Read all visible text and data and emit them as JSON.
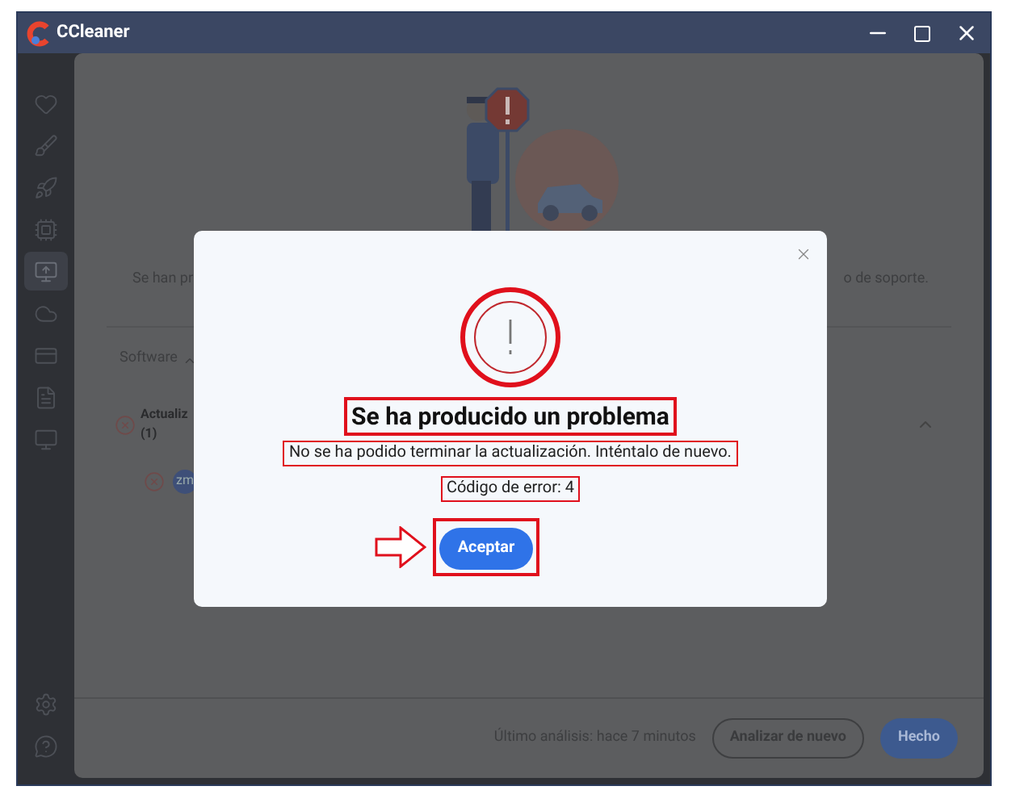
{
  "window": {
    "title": "CCleaner"
  },
  "sidebar": {
    "items": [
      {
        "kind": "heart",
        "selected": false
      },
      {
        "kind": "brush",
        "selected": false
      },
      {
        "kind": "rocket",
        "selected": false
      },
      {
        "kind": "chip",
        "selected": false
      },
      {
        "kind": "updater",
        "selected": true
      },
      {
        "kind": "cloud",
        "selected": false
      },
      {
        "kind": "card",
        "selected": false
      },
      {
        "kind": "file",
        "selected": false
      },
      {
        "kind": "monitor",
        "selected": false
      }
    ],
    "bottom_items": [
      {
        "kind": "settings",
        "selected": false
      },
      {
        "kind": "support",
        "selected": false
      }
    ]
  },
  "background": {
    "intro_left": "Se han pr",
    "intro_right": "o de soporte.",
    "section": "Software",
    "item_title": "Actualiz",
    "item_count": "(1)",
    "app_badge": "zm"
  },
  "footer": {
    "last_scan": "Último análisis: hace 7 minutos",
    "rescan_button": "Analizar de nuevo",
    "done_button": "Hecho"
  },
  "dialog": {
    "title": "Se ha producido un problema",
    "message": "No se ha podido terminar la actualización. Inténtalo de nuevo.",
    "error_code": "Código de error: 4",
    "button": "Aceptar"
  }
}
